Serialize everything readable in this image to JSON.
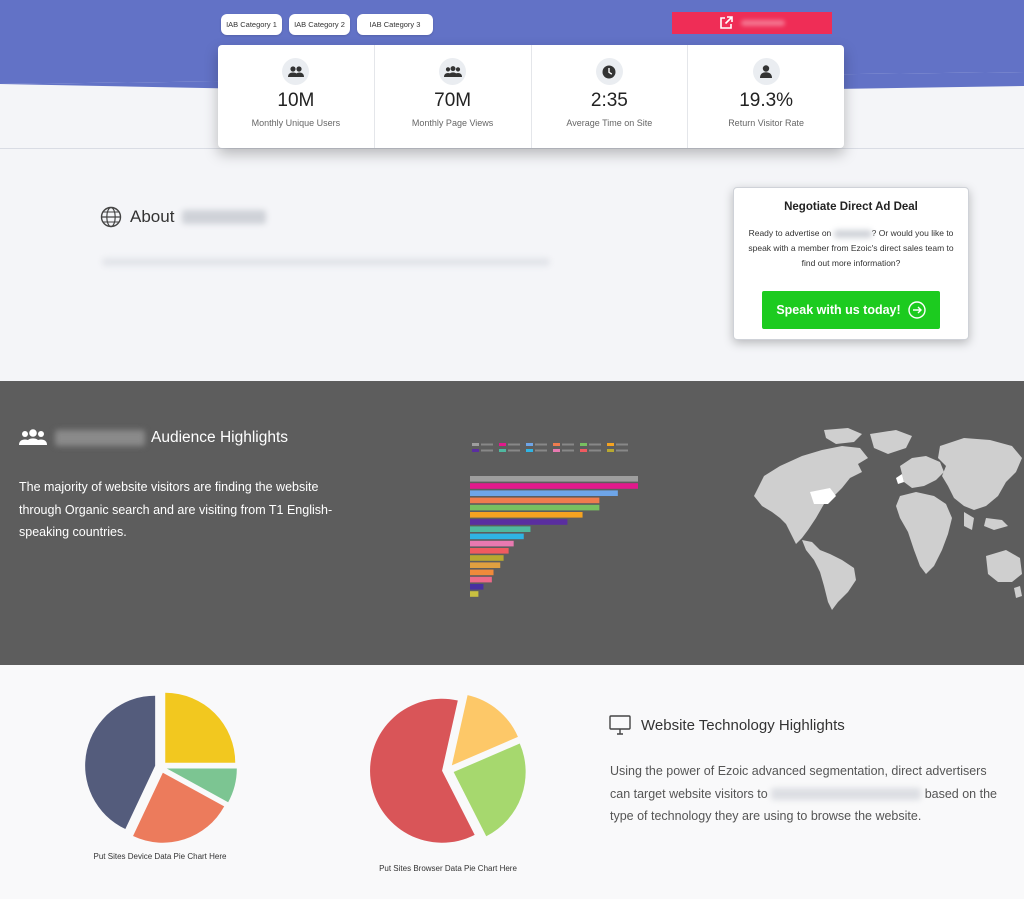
{
  "header": {
    "iab_categories": [
      "IAB Category 1",
      "IAB Category 2",
      "IAB Category 3"
    ],
    "colors": {
      "band": "#6272c6",
      "accent_button": "#ef2d56"
    },
    "stats": [
      {
        "icon": "users-icon",
        "value": "10M",
        "label": "Monthly Unique Users"
      },
      {
        "icon": "users-group-icon",
        "value": "70M",
        "label": "Monthly Page Views"
      },
      {
        "icon": "clock-icon",
        "value": "2:35",
        "label": "Average Time on Site"
      },
      {
        "icon": "user-icon",
        "value": "19.3%",
        "label": "Return Visitor Rate"
      }
    ]
  },
  "about": {
    "title": "About"
  },
  "deal": {
    "title": "Negotiate Direct Ad Deal",
    "text_before": "Ready to advertise on",
    "text_after": "? Or would you like to speak with a member from Ezoic's direct sales team to find out more information?",
    "button_label": "Speak with us today!",
    "button_color": "#1ccb1f"
  },
  "audience": {
    "title": "Audience Highlights",
    "text": "The majority of website visitors are finding the website through Organic search and are visiting from T1 English-speaking countries.",
    "background": "#5d5d5d"
  },
  "technology": {
    "title": "Website Technology Highlights",
    "text_before": "Using the power of Ezoic advanced segmentation, direct advertisers can target website visitors to",
    "text_after": "based on the type of technology they are using to browse the website.",
    "device_caption": "Put Sites Device Data Pie Chart Here",
    "browser_caption": "Put Sites Browser Data Pie Chart Here"
  },
  "chart_data": [
    {
      "type": "bar",
      "orientation": "horizontal",
      "series": [
        {
          "color": "#9e9e9e",
          "value": 1.0
        },
        {
          "color": "#e2198c",
          "value": 1.0
        },
        {
          "color": "#6ea5e8",
          "value": 0.88
        },
        {
          "color": "#ef7c4e",
          "value": 0.77
        },
        {
          "color": "#78c060",
          "value": 0.77
        },
        {
          "color": "#f5a320",
          "value": 0.67
        },
        {
          "color": "#5a2ea0",
          "value": 0.58
        },
        {
          "color": "#4fb8a0",
          "value": 0.36
        },
        {
          "color": "#2fb4e4",
          "value": 0.32
        },
        {
          "color": "#e879b0",
          "value": 0.26
        },
        {
          "color": "#f05a60",
          "value": 0.23
        },
        {
          "color": "#b8a830",
          "value": 0.2
        },
        {
          "color": "#e0a040",
          "value": 0.18
        },
        {
          "color": "#f08a3a",
          "value": 0.14
        },
        {
          "color": "#ee6a8a",
          "value": 0.13
        },
        {
          "color": "#4830a0",
          "value": 0.08
        },
        {
          "color": "#c8c040",
          "value": 0.05
        }
      ]
    },
    {
      "type": "pie",
      "slices": [
        {
          "color": "#f2c81f",
          "value": 25
        },
        {
          "color": "#7cc592",
          "value": 8
        },
        {
          "color": "#ec7b5c",
          "value": 24
        },
        {
          "color": "#545c7c",
          "value": 43
        }
      ]
    },
    {
      "type": "pie",
      "slices": [
        {
          "color": "#fdc868",
          "value": 15
        },
        {
          "color": "#a6d86e",
          "value": 24
        },
        {
          "color": "#d95558",
          "value": 61
        }
      ]
    }
  ]
}
